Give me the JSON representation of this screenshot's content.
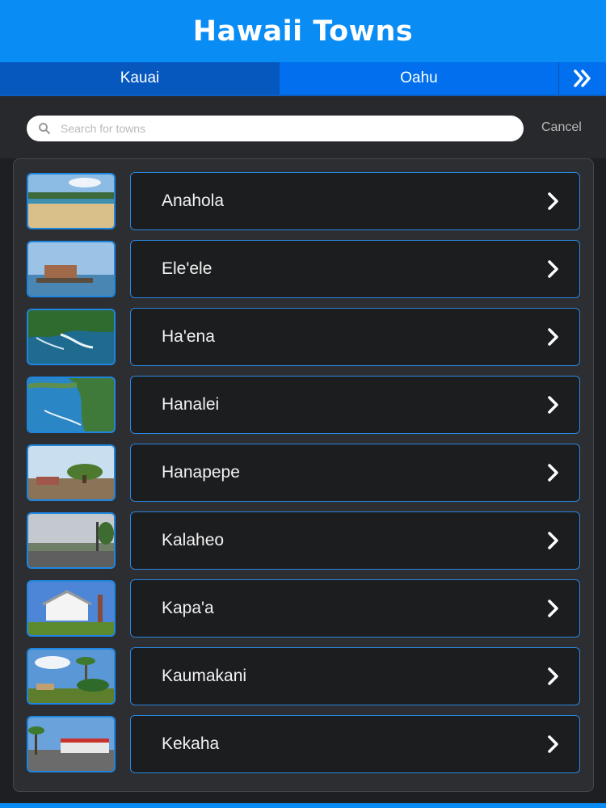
{
  "header": {
    "title": "Hawaii Towns"
  },
  "tabs": [
    {
      "label": "Kauai",
      "selected": true
    },
    {
      "label": "Oahu",
      "selected": false
    }
  ],
  "tab_next_icon": "double-chevron-right-icon",
  "search": {
    "placeholder": "Search for towns",
    "value": "",
    "cancel_label": "Cancel"
  },
  "colors": {
    "header": "#0a8cf5",
    "tab_bar": "#0270ee",
    "tab_selected": "#0658bf",
    "card_border": "#2a87e0",
    "background": "#1d1f22"
  },
  "towns": [
    {
      "name": "Anahola",
      "scene": "beach"
    },
    {
      "name": "Ele'ele",
      "scene": "harbor"
    },
    {
      "name": "Ha'ena",
      "scene": "coast-aerial"
    },
    {
      "name": "Hanalei",
      "scene": "bay"
    },
    {
      "name": "Hanapepe",
      "scene": "town-tree"
    },
    {
      "name": "Kalaheo",
      "scene": "cloudy-town"
    },
    {
      "name": "Kapa'a",
      "scene": "church"
    },
    {
      "name": "Kaumakani",
      "scene": "palms"
    },
    {
      "name": "Kekaha",
      "scene": "storefront"
    }
  ]
}
